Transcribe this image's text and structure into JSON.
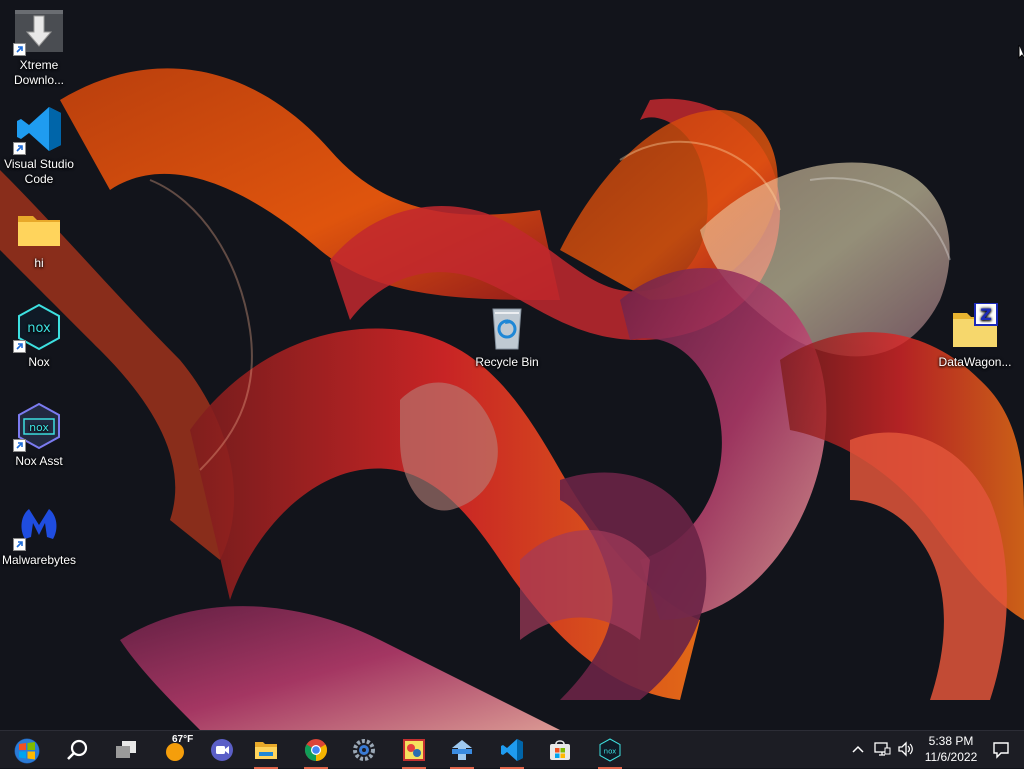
{
  "desktop": {
    "icons": [
      {
        "label": "Xtreme Downlo...",
        "icon": "xtreme-download-icon",
        "shortcut": true
      },
      {
        "label": "Visual Studio Code",
        "icon": "vscode-icon",
        "shortcut": true
      },
      {
        "label": "hi",
        "icon": "folder-icon",
        "shortcut": false
      },
      {
        "label": "Nox",
        "icon": "nox-icon",
        "shortcut": true
      },
      {
        "label": "Nox Asst",
        "icon": "nox-assistant-icon",
        "shortcut": true
      },
      {
        "label": "Malwarebytes",
        "icon": "malwarebytes-icon",
        "shortcut": true
      },
      {
        "label": "Recycle Bin",
        "icon": "recycle-bin-icon",
        "shortcut": false
      },
      {
        "label": "DataWagon...",
        "icon": "zip-folder-icon",
        "shortcut": false
      }
    ]
  },
  "taskbar": {
    "weather_temp": "67°F",
    "apps": [
      "start-icon",
      "search-icon",
      "task-view-icon",
      "weather-icon",
      "chat-icon",
      "file-explorer-icon",
      "chrome-icon",
      "settings-icon",
      "game-app-icon",
      "vpn-app-icon",
      "vscode-icon",
      "store-icon",
      "nox-icon"
    ],
    "tray": [
      "show-hidden-icons-icon",
      "network-icon",
      "volume-icon"
    ],
    "clock": {
      "time": "5:38 PM",
      "date": "11/6/2022"
    },
    "notification_icon": "notification-icon"
  },
  "colors": {
    "taskbar_bg": "#1c1d24",
    "accent": "#e0654a",
    "desktop_bg": "#11131a"
  }
}
